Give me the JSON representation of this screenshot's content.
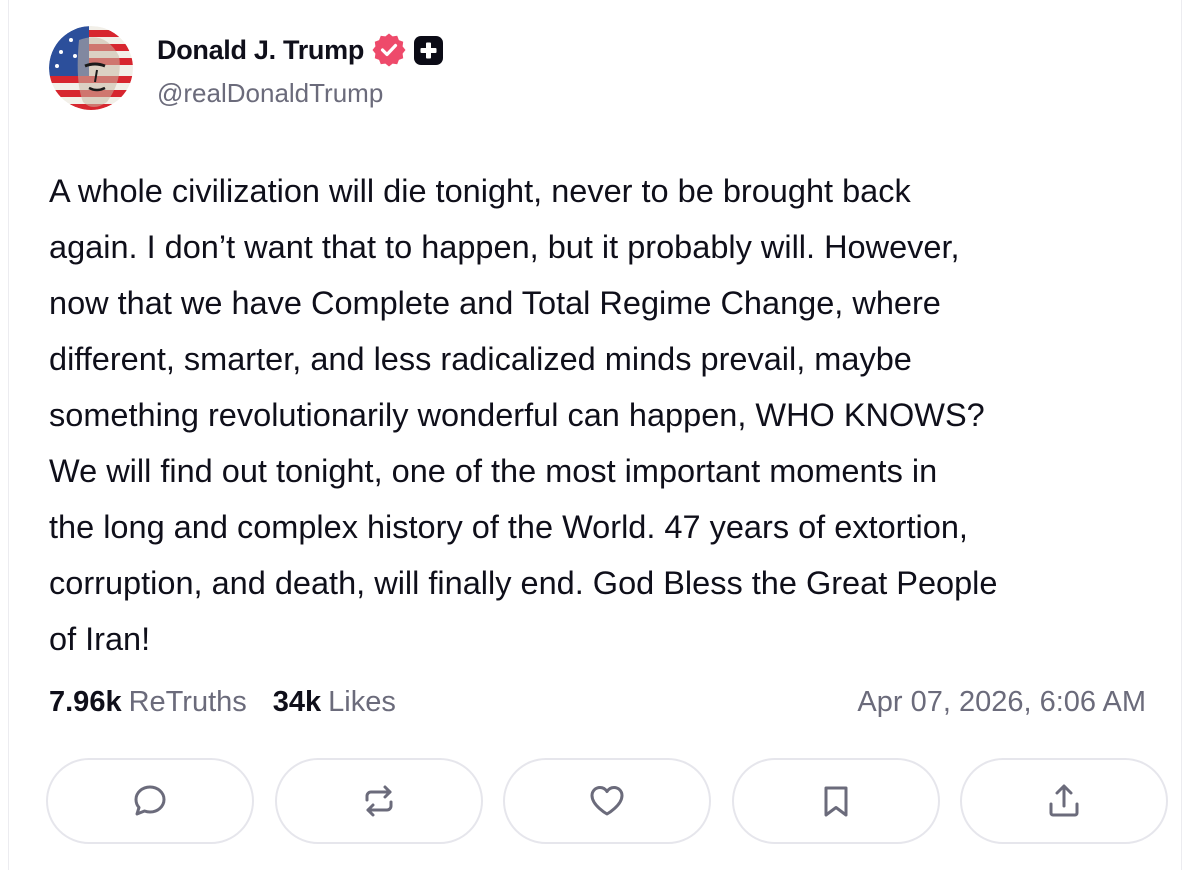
{
  "post": {
    "author": {
      "display_name": "Donald J. Trump",
      "handle": "@realDonaldTrump",
      "verified_icon": "verified-badge-icon",
      "extra_icon": "plus-badge-icon"
    },
    "body": "A whole civilization will die tonight, never to be brought back\nagain. I don’t want that to happen, but it probably will. However,\nnow that we have Complete and Total Regime Change, where\ndifferent, smarter, and less radicalized minds prevail, maybe\nsomething revolutionarily wonderful can happen, WHO KNOWS?\nWe will find out tonight, one of the most important moments in\nthe long and complex history of the World. 47 years of extortion,\ncorruption, and death, will finally end. God Bless the Great People\nof Iran!",
    "stats": {
      "retruths_count": "7.96k",
      "retruths_label": "ReTruths",
      "likes_count": "34k",
      "likes_label": "Likes"
    },
    "timestamp": "Apr 07, 2026, 6:06 AM"
  },
  "actions": [
    {
      "name": "reply",
      "icon": "comment-icon"
    },
    {
      "name": "retruth",
      "icon": "repost-icon"
    },
    {
      "name": "like",
      "icon": "heart-icon"
    },
    {
      "name": "bookmark",
      "icon": "bookmark-icon"
    },
    {
      "name": "share",
      "icon": "share-icon"
    }
  ],
  "colors": {
    "text": "#0f0f1a",
    "muted": "#6b6b7b",
    "verified_badge": "#ee4a6b",
    "button_border": "#e6e6ec",
    "icon": "#6b6b7b"
  }
}
